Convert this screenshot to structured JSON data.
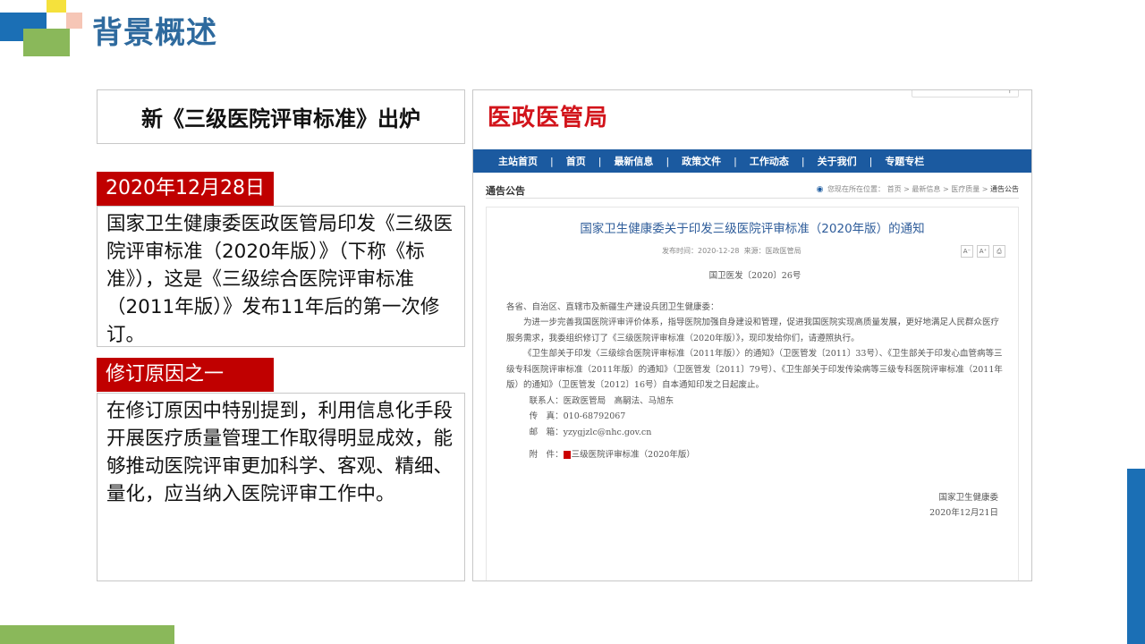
{
  "slide": {
    "title": "背景概述",
    "headline": "新《三级医院评审标准》出炉",
    "section1": {
      "tag": "2020年12月28日",
      "text": "国家卫生健康委医政医管局印发《三级医院评审标准（2020年版）》（下称《标准》），这是《三级综合医院评审标准（2011年版）》发布11年后的第一次修订。"
    },
    "section2": {
      "tag": "修订原因之一",
      "text": "在修订原因中特别提到，利用信息化手段开展医疗质量管理工作取得明显成效，能够推动医院评审更加科学、客观、精细、量化，应当纳入医院评审工作中。"
    }
  },
  "colors": {
    "title": "#2e6a9e",
    "tag_bg": "#c00000",
    "nav_bg": "#1b5aa0",
    "logo_red": "#d2141b",
    "deco_yellow": "#f5e13c",
    "deco_blue": "#1b6fb5",
    "deco_green": "#8ab85a",
    "deco_pink": "#f6c6b6"
  },
  "screenshot": {
    "site_logo": "医政医管局",
    "nav": [
      "主站首页",
      "首页",
      "最新信息",
      "政策文件",
      "工作动态",
      "关于我们",
      "专题专栏"
    ],
    "nav_separator": "|",
    "crumb_title": "通告公告",
    "crumb_prefix": "您现在所在位置：",
    "crumb_path": [
      "首页",
      "最新信息",
      "医疗质量",
      "通告公告"
    ],
    "crumb_sep": ">",
    "article_title": "国家卫生健康委关于印发三级医院评审标准（2020年版）的通知",
    "publish_label": "发布时间：",
    "publish_date": "2020-12-28",
    "source_label": "来源：",
    "source": "医政医管局",
    "tools": [
      "A⁻",
      "A⁺",
      "⎙"
    ],
    "doc_no": "国卫医发〔2020〕26号",
    "salutation": "各省、自治区、直辖市及新疆生产建设兵团卫生健康委：",
    "para1": "为进一步完善我国医院评审评价体系，指导医院加强自身建设和管理，促进我国医院实现高质量发展，更好地满足人民群众医疗服务需求，我委组织修订了《三级医院评审标准（2020年版）》，现印发给你们，请遵照执行。",
    "para2": "《卫生部关于印发〈三级综合医院评审标准（2011年版）〉的通知》（卫医管发〔2011〕33号）、《卫生部关于印发心血管病等三级专科医院评审标准（2011年版）的通知》（卫医管发〔2011〕79号）、《卫生部关于印发传染病等三级专科医院评审标准（2011年版）的通知》（卫医管发〔2012〕16号）自本通知印发之日起废止。",
    "contact": "联系人：医政医管局　高嗣法、马旭东",
    "phone": "传　真：010-68792067",
    "email": "邮　箱：yzygjzlc@nhc.gov.cn",
    "attach_label": "附　件：",
    "attachment": "三级医院评审标准（2020年版）",
    "signer": "国家卫生健康委",
    "sign_date": "2020年12月21日"
  }
}
